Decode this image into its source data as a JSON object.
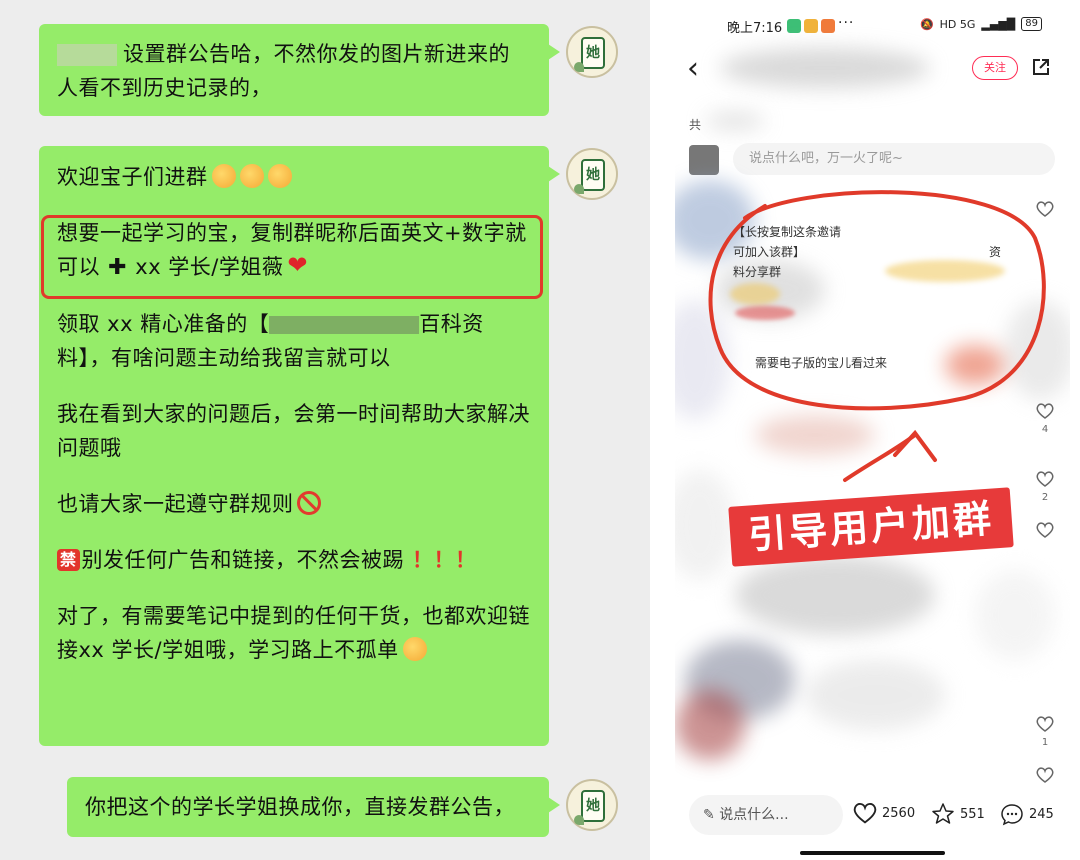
{
  "chat": {
    "avatar_tile_char": "她",
    "msg1": {
      "text": "设置群公告哈，不然你发的图片新进来的人看不到历史记录的，"
    },
    "msg2": {
      "para1": "欢迎宝子们进群",
      "para2_line": "想要一起学习的宝，复制群昵称后面英文+数字就可以",
      "para2_tail": "xx 学长/学姐薇",
      "para3_a": "领取 xx 精心准备的【",
      "para3_b": "百科资料】，有啥问题主动给我留言就可以",
      "para4": "我在看到大家的问题后，会第一时间帮助大家解决问题哦",
      "para5": "也请大家一起遵守群规则",
      "para6_badge": "禁",
      "para6": "别发任何广告和链接，不然会被踢",
      "para6_excl": "！！！",
      "para7": "对了，有需要笔记中提到的任何干货，也都欢迎链接xx 学长/学姐哦，学习路上不孤单"
    },
    "msg3": {
      "text": "你把这个的学长学姐换成你，直接发群公告，"
    }
  },
  "phone": {
    "status": {
      "time": "晚上7:16",
      "dots": "···",
      "network": "HD 5G",
      "battery": "89"
    },
    "follow_label": "关注",
    "total_label": "共",
    "comment_placeholder": "说点什么吧，万一火了呢~",
    "comment_lines": [
      "【长按复制这条邀请",
      "可加入该群】",
      "资",
      "料分享群",
      "需要电子版的宝儿看过来"
    ],
    "like_counts": [
      "4",
      "2",
      "1"
    ],
    "banner_text": "引导用户加群",
    "bottom": {
      "input_label": "说点什么...",
      "likes": "2560",
      "stars": "551",
      "comments": "245"
    }
  },
  "colors": {
    "bubble_green": "#95ec69",
    "highlight_red": "#e03a2a",
    "banner_red": "#e73a3a",
    "accent_pink": "#ff2d55"
  }
}
